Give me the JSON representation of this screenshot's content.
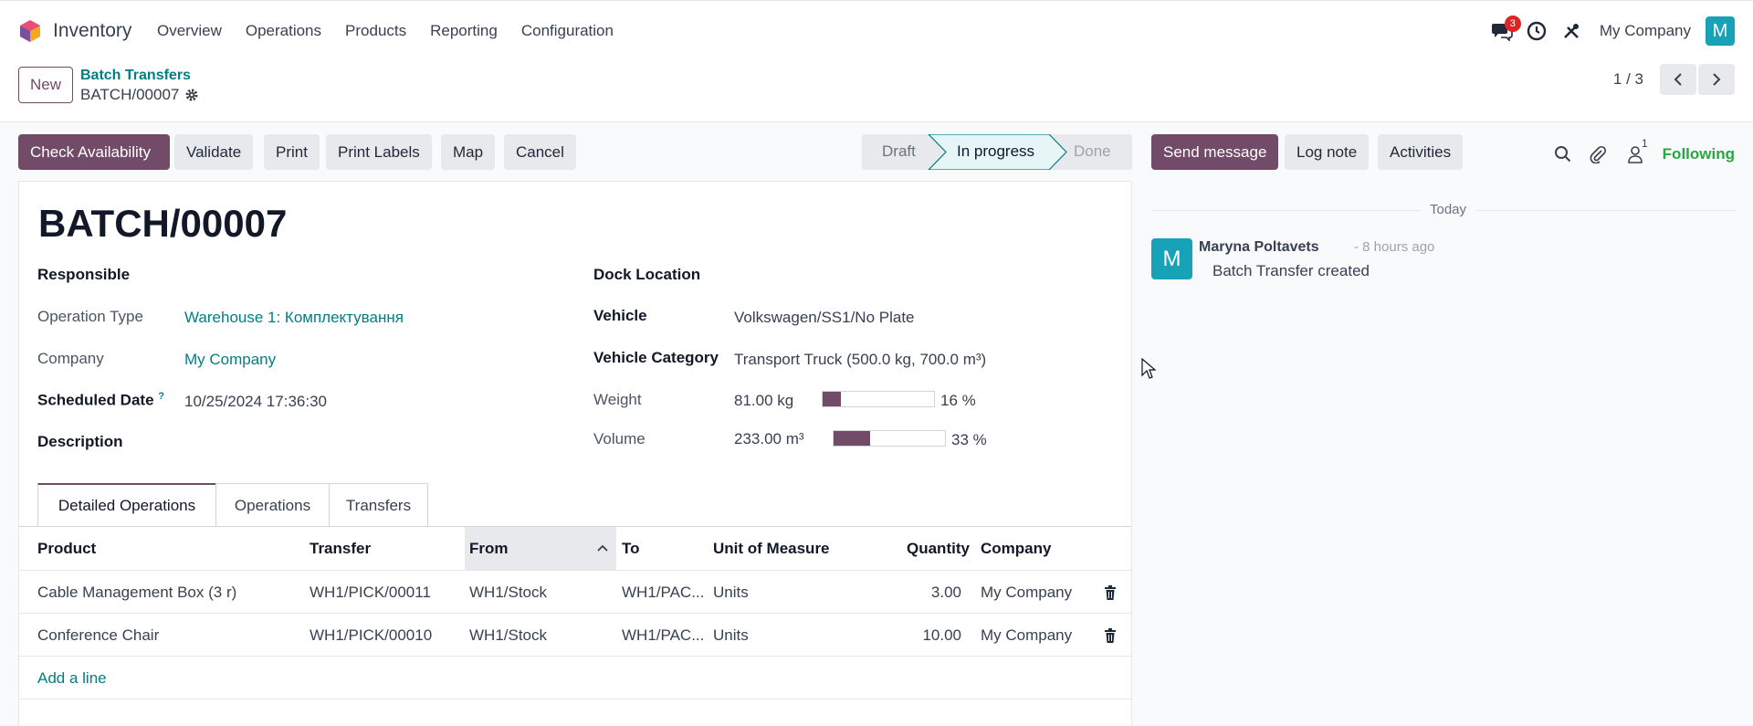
{
  "navbar": {
    "app_name": "Inventory",
    "menu": [
      "Overview",
      "Operations",
      "Products",
      "Reporting",
      "Configuration"
    ],
    "messages_badge": "3",
    "company": "My Company",
    "avatar_letter": "M",
    "avatar_color": "#17a2b8"
  },
  "control": {
    "new_label": "New",
    "breadcrumb_parent": "Batch Transfers",
    "breadcrumb_current": "BATCH/00007",
    "pager": "1 / 3"
  },
  "actions": {
    "check_availability": "Check Availability",
    "validate": "Validate",
    "print": "Print",
    "print_labels": "Print Labels",
    "map": "Map",
    "cancel": "Cancel"
  },
  "status": {
    "steps": [
      "Draft",
      "In progress",
      "Done"
    ],
    "current": "In progress"
  },
  "form": {
    "title": "BATCH/00007",
    "responsible_label": "Responsible",
    "operation_type_label": "Operation Type",
    "operation_type_value": "Warehouse 1: Комплектування",
    "company_label": "Company",
    "company_value": "My Company",
    "scheduled_date_label": "Scheduled Date",
    "scheduled_date_help": "?",
    "scheduled_date_value": "10/25/2024 17:36:30",
    "description_label": "Description",
    "dock_location_label": "Dock Location",
    "vehicle_label": "Vehicle",
    "vehicle_value": "Volkswagen/SS1/No Plate",
    "vehicle_category_label": "Vehicle Category",
    "vehicle_category_value": "Transport Truck (500.0 kg, 700.0 m³)",
    "weight_label": "Weight",
    "weight_value": "81.00 kg",
    "weight_percent": 16,
    "weight_percent_text": "16 %",
    "volume_label": "Volume",
    "volume_value": "233.00 m³",
    "volume_percent": 33,
    "volume_percent_text": "33 %"
  },
  "tabs": [
    "Detailed Operations",
    "Operations",
    "Transfers"
  ],
  "table": {
    "headers": [
      "Product",
      "Transfer",
      "From",
      "To",
      "Unit of Measure",
      "Quantity",
      "Company"
    ],
    "rows": [
      [
        "Cable Management Box (3 r)",
        "WH1/PICK/00011",
        "WH1/Stock",
        "WH1/PAC...",
        "Units",
        "3.00",
        "My Company"
      ],
      [
        "Conference Chair",
        "WH1/PICK/00010",
        "WH1/Stock",
        "WH1/PAC...",
        "Units",
        "10.00",
        "My Company"
      ]
    ],
    "add_line": "Add a line"
  },
  "chatter": {
    "send_message": "Send message",
    "log_note": "Log note",
    "activities": "Activities",
    "followers_count": "1",
    "following": "Following",
    "date_separator": "Today",
    "message": {
      "avatar_letter": "M",
      "author": "Maryna Poltavets",
      "time": "- 8 hours ago",
      "body": "Batch Transfer created"
    }
  },
  "colors": {
    "brand": "#714b67",
    "link": "#017e84",
    "following": "#28a745"
  }
}
